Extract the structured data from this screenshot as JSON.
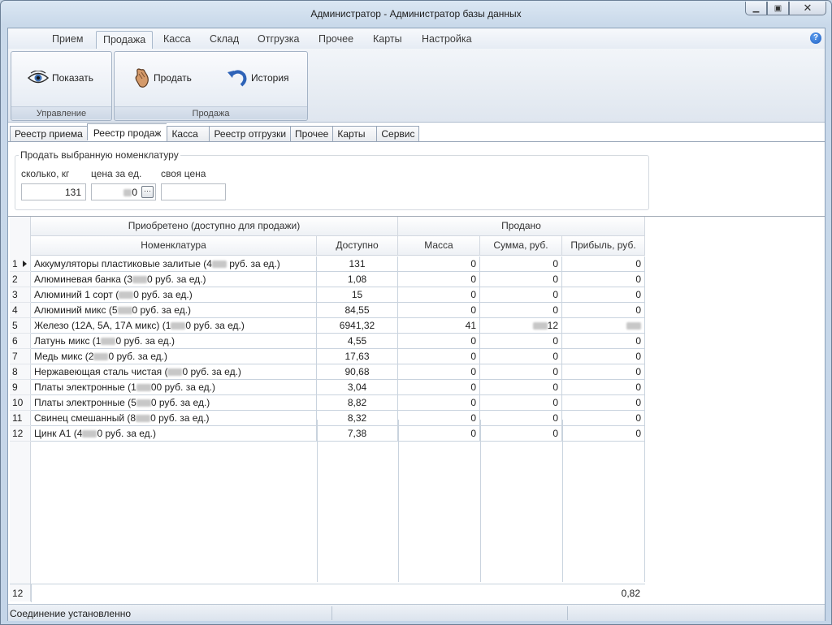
{
  "window": {
    "title": "Администратор - Администратор базы данных"
  },
  "ribbon": {
    "tabs": [
      "Прием",
      "Продажа",
      "Касса",
      "Склад",
      "Отгрузка",
      "Прочее",
      "Карты",
      "Настройка"
    ],
    "active_tab": "Продажа",
    "groups": [
      {
        "label": "Управление",
        "buttons": [
          {
            "label": "Показать",
            "icon": "eye-icon"
          }
        ]
      },
      {
        "label": "Продажа",
        "buttons": [
          {
            "label": "Продать",
            "icon": "hand-icon"
          },
          {
            "label": "История",
            "icon": "undo-arrow-icon"
          }
        ]
      }
    ]
  },
  "subtabs": [
    "Реестр приема",
    "Реестр продаж",
    "Касса",
    "Реестр отгрузки",
    "Прочее",
    "Карты",
    "Сервис"
  ],
  "active_subtab": "Реестр продаж",
  "sell_panel": {
    "legend": "Продать выбранную номенклатуру",
    "qty_label": "сколько, кг",
    "qty_value": "131",
    "price_label": "цена за ед.",
    "price_value": "0",
    "ownprice_label": "своя цена",
    "ownprice_value": ""
  },
  "grid": {
    "group_headers": [
      "Приобретено (доступно для продажи)",
      "Продано"
    ],
    "columns": [
      "Номенклатура",
      "Доступно",
      "Масса",
      "Сумма, руб.",
      "Прибыль, руб."
    ],
    "rows": [
      {
        "n": "1",
        "name_pre": "Аккумуляторы пластиковые залитые (4",
        "name_post": " руб. за ед.)",
        "avail": "131",
        "mass": "0",
        "sum": "0",
        "profit": "0"
      },
      {
        "n": "2",
        "name_pre": "Алюминевая банка (3",
        "name_post": "0 руб. за ед.)",
        "avail": "1,08",
        "mass": "0",
        "sum": "0",
        "profit": "0"
      },
      {
        "n": "3",
        "name_pre": "Алюминий 1 сорт (",
        "name_post": "0 руб. за ед.)",
        "avail": "15",
        "mass": "0",
        "sum": "0",
        "profit": "0"
      },
      {
        "n": "4",
        "name_pre": "Алюминий микс (5",
        "name_post": "0 руб. за ед.)",
        "avail": "84,55",
        "mass": "0",
        "sum": "0",
        "profit": "0"
      },
      {
        "n": "5",
        "name_pre": "Железо (12А, 5А, 17А микс) (1",
        "name_post": "0 руб. за ед.)",
        "avail": "6941,32",
        "mass": "41",
        "sum": "12",
        "profit": "",
        "sum_blur": true,
        "profit_blur": true
      },
      {
        "n": "6",
        "name_pre": "Латунь микс (1",
        "name_post": "0 руб. за ед.)",
        "avail": "4,55",
        "mass": "0",
        "sum": "0",
        "profit": "0"
      },
      {
        "n": "7",
        "name_pre": "Медь микс (2",
        "name_post": "0 руб. за ед.)",
        "avail": "17,63",
        "mass": "0",
        "sum": "0",
        "profit": "0"
      },
      {
        "n": "8",
        "name_pre": "Нержавеющая сталь чистая (",
        "name_post": "0 руб. за ед.)",
        "avail": "90,68",
        "mass": "0",
        "sum": "0",
        "profit": "0"
      },
      {
        "n": "9",
        "name_pre": "Платы электронные (1",
        "name_post": "00 руб. за ед.)",
        "avail": "3,04",
        "mass": "0",
        "sum": "0",
        "profit": "0"
      },
      {
        "n": "10",
        "name_pre": "Платы электронные (5",
        "name_post": "0 руб. за ед.)",
        "avail": "8,82",
        "mass": "0",
        "sum": "0",
        "profit": "0"
      },
      {
        "n": "11",
        "name_pre": "Свинец смешанный (8",
        "name_post": "0 руб. за ед.)",
        "avail": "8,32",
        "mass": "0",
        "sum": "0",
        "profit": "0"
      },
      {
        "n": "12",
        "name_pre": "Цинк А1 (4",
        "name_post": "0 руб. за ед.)",
        "avail": "7,38",
        "mass": "0",
        "sum": "0",
        "profit": "0"
      }
    ],
    "footer_count": "12",
    "footer_profit": "0,82"
  },
  "status": {
    "text": "Соединение установленно"
  }
}
